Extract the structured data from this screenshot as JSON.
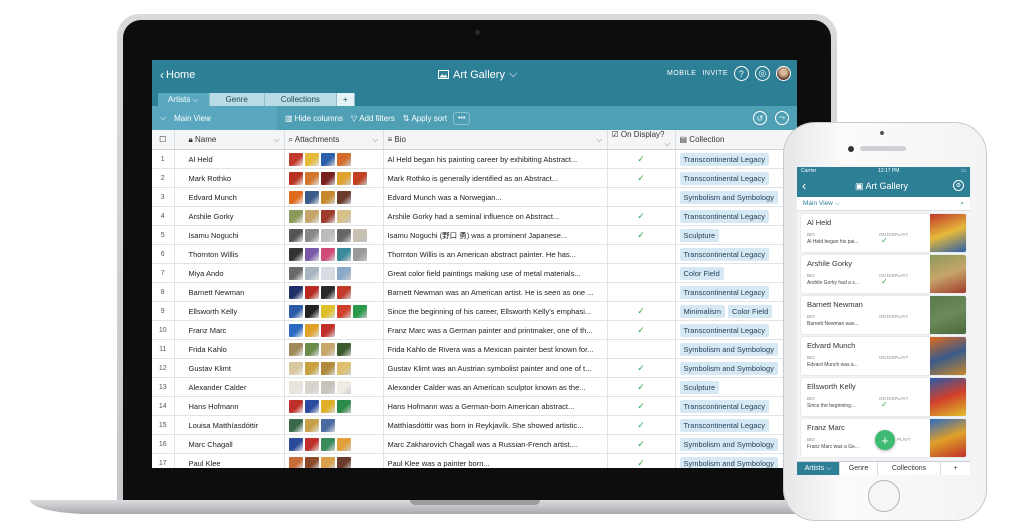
{
  "laptop": {
    "header": {
      "back_label": "Home",
      "title": "Art Gallery",
      "mobile_label": "MOBILE",
      "invite_label": "INVITE",
      "help_glyph": "?"
    },
    "tabs": [
      {
        "label": "Artists",
        "active": true
      },
      {
        "label": "Genre",
        "active": false
      },
      {
        "label": "Collections",
        "active": false
      },
      {
        "label": "+",
        "active": false
      }
    ],
    "view_bar": {
      "view_name": "Main View",
      "hide_columns": "Hide columns",
      "add_filters": "Add filters",
      "apply_sort": "Apply sort",
      "more": "•••"
    },
    "columns": {
      "name": "Name",
      "attachments": "Attachments",
      "bio": "Bio",
      "on_display": "On Display?",
      "collection": "Collection"
    },
    "rows": [
      {
        "num": "1",
        "name": "Al Held",
        "bio": "Al Held began his painting career by exhibiting Abstract...",
        "on_display": true,
        "collections": [
          "Transcontinental Legacy"
        ],
        "thumbs": [
          "#c0392b",
          "#e5b93a",
          "#2b5ea8",
          "#d46b2a"
        ]
      },
      {
        "num": "2",
        "name": "Mark Rothko",
        "bio": "Mark Rothko is generally identified as an Abstract...",
        "on_display": true,
        "collections": [
          "Transcontinental Legacy"
        ],
        "thumbs": [
          "#b8321f",
          "#d2762e",
          "#7a1f1f",
          "#e0a32e",
          "#c2401f"
        ]
      },
      {
        "num": "3",
        "name": "Edvard Munch",
        "bio": "Edvard Munch was a Norwegian...",
        "on_display": false,
        "collections": [
          "Symbolism and Symbology"
        ],
        "thumbs": [
          "#e06a1c",
          "#3a5a8a",
          "#c8882c",
          "#6a3a2a"
        ]
      },
      {
        "num": "4",
        "name": "Arshile Gorky",
        "bio": "Arshile Gorky had a seminal influence on Abstract...",
        "on_display": true,
        "collections": [
          "Transcontinental Legacy"
        ],
        "thumbs": [
          "#8b9a5a",
          "#c7a56a",
          "#a03a2a",
          "#d8c08a"
        ]
      },
      {
        "num": "5",
        "name": "Isamu Noguchi",
        "bio": "Isamu Noguchi (野口 勇) was a prominent Japanese...",
        "on_display": true,
        "collections": [
          "Sculpture"
        ],
        "thumbs": [
          "#555555",
          "#888888",
          "#bbbbbb",
          "#666666",
          "#c8c0b0"
        ]
      },
      {
        "num": "6",
        "name": "Thornton Willis",
        "bio": "Thornton Willis is an American abstract painter. He has...",
        "on_display": false,
        "collections": [
          "Transcontinental Legacy"
        ],
        "thumbs": [
          "#333333",
          "#7a5aa8",
          "#d04a7a",
          "#3a8a9a",
          "#9a9a9a"
        ]
      },
      {
        "num": "7",
        "name": "Miya Ando",
        "bio": "Great color field paintings making use of metal materials...",
        "on_display": false,
        "collections": [
          "Color Field"
        ],
        "thumbs": [
          "#6a6a6a",
          "#a9b4c2",
          "#d8dde4",
          "#8aa8c8"
        ]
      },
      {
        "num": "8",
        "name": "Barnett Newman",
        "bio": "Barnett Newman was an American artist. He is seen as one ...",
        "on_display": false,
        "collections": [
          "Transcontinental Legacy"
        ],
        "thumbs": [
          "#1f2f6a",
          "#b82a1f",
          "#2a2a2a",
          "#c23a2a"
        ]
      },
      {
        "num": "9",
        "name": "Ellsworth Kelly",
        "bio": "Since the beginning of his career, Ellsworth Kelly's emphasi...",
        "on_display": true,
        "collections": [
          "Minimalism",
          "Color Field"
        ],
        "thumbs": [
          "#2a5aa8",
          "#222222",
          "#e0c02a",
          "#d0402a",
          "#2a9a4a"
        ]
      },
      {
        "num": "10",
        "name": "Franz Marc",
        "bio": "Franz Marc was a German painter and printmaker, one of th...",
        "on_display": true,
        "collections": [
          "Transcontinental Legacy"
        ],
        "thumbs": [
          "#2a6ac0",
          "#e0a02a",
          "#c0302a"
        ]
      },
      {
        "num": "11",
        "name": "Frida Kahlo",
        "bio": "Frida Kahlo de Rivera was a Mexican painter best known for...",
        "on_display": false,
        "collections": [
          "Symbolism and Symbology"
        ],
        "thumbs": [
          "#a08a5a",
          "#6a8a4a",
          "#c8a86a",
          "#3a5a2a"
        ]
      },
      {
        "num": "12",
        "name": "Gustav Klimt",
        "bio": "Gustav Klimt was an Austrian symbolist painter and one of t...",
        "on_display": true,
        "collections": [
          "Symbolism and Symbology"
        ],
        "thumbs": [
          "#d8c8a0",
          "#c8a040",
          "#b08a3a",
          "#e0c070"
        ]
      },
      {
        "num": "13",
        "name": "Alexander Calder",
        "bio": "Alexander Calder was an American sculptor known as the...",
        "on_display": true,
        "collections": [
          "Sculpture"
        ],
        "thumbs": [
          "#e8e4dc",
          "#d8d4cc",
          "#c8c4bc",
          "#f0ece4"
        ]
      },
      {
        "num": "14",
        "name": "Hans Hofmann",
        "bio": "Hans Hofmann was a German-born American abstract...",
        "on_display": true,
        "collections": [
          "Transcontinental Legacy"
        ],
        "thumbs": [
          "#c0302a",
          "#2a4aa0",
          "#e0b02a",
          "#2a8a4a"
        ]
      },
      {
        "num": "15",
        "name": "Louisa Matthíasdóttir",
        "bio": "Matthíasdóttir was born in Reykjavík. She showed artistic...",
        "on_display": true,
        "collections": [
          "Transcontinental Legacy"
        ],
        "thumbs": [
          "#3a6a4a",
          "#c8a04a",
          "#4a6aa0"
        ]
      },
      {
        "num": "16",
        "name": "Marc Chagall",
        "bio": "Marc Zakharovich Chagall was a Russian-French artist....",
        "on_display": true,
        "collections": [
          "Symbolism and Symbology"
        ],
        "thumbs": [
          "#2a4a9a",
          "#c0302a",
          "#3a8a5a",
          "#e0a03a"
        ]
      },
      {
        "num": "17",
        "name": "Paul Klee",
        "bio": "Paul Klee was a painter born...",
        "on_display": true,
        "collections": [
          "Symbolism and Symbology"
        ],
        "thumbs": [
          "#c86a3a",
          "#8a4a2a",
          "#d8a04a",
          "#6a3a2a"
        ]
      }
    ]
  },
  "phone": {
    "status": {
      "carrier": "Carrier",
      "time": "12:17 PM"
    },
    "title": "Art Gallery",
    "view_name": "Main View",
    "labels": {
      "bio": "BIO",
      "on_display": "ON DISPLAY?"
    },
    "cards": [
      {
        "name": "Al Held",
        "bio": "Al Held began his pai...",
        "on_display": true,
        "img": [
          "#c0392b",
          "#e5b93a",
          "#2b5ea8"
        ]
      },
      {
        "name": "Arshile Gorky",
        "bio": "Arshile Gorky had a s...",
        "on_display": true,
        "img": [
          "#8b9a5a",
          "#c7a56a",
          "#a03a2a"
        ]
      },
      {
        "name": "Barnett Newman",
        "bio": "Barnett Newman was...",
        "on_display": false,
        "img": [
          "#5a7a4a",
          "#6a8a5a",
          "#4a6a3a"
        ]
      },
      {
        "name": "Edvard Munch",
        "bio": "Edvard Munch was a...",
        "on_display": false,
        "img": [
          "#e06a1c",
          "#3a5a8a",
          "#c8882c"
        ]
      },
      {
        "name": "Ellsworth Kelly",
        "bio": "Since the beginning...",
        "on_display": true,
        "img": [
          "#2a5aa8",
          "#d0402a",
          "#e0c02a"
        ]
      },
      {
        "name": "Franz Marc",
        "bio": "Franz Marc was a Ge...",
        "on_display": false,
        "img": [
          "#2a6ac0",
          "#e0a02a",
          "#c0302a"
        ]
      }
    ],
    "partial_label": "PLAY?",
    "fab": "+",
    "tabs": [
      {
        "label": "Artists",
        "active": true
      },
      {
        "label": "Genre",
        "active": false
      },
      {
        "label": "Collections",
        "active": false
      },
      {
        "label": "+",
        "active": false
      }
    ]
  }
}
